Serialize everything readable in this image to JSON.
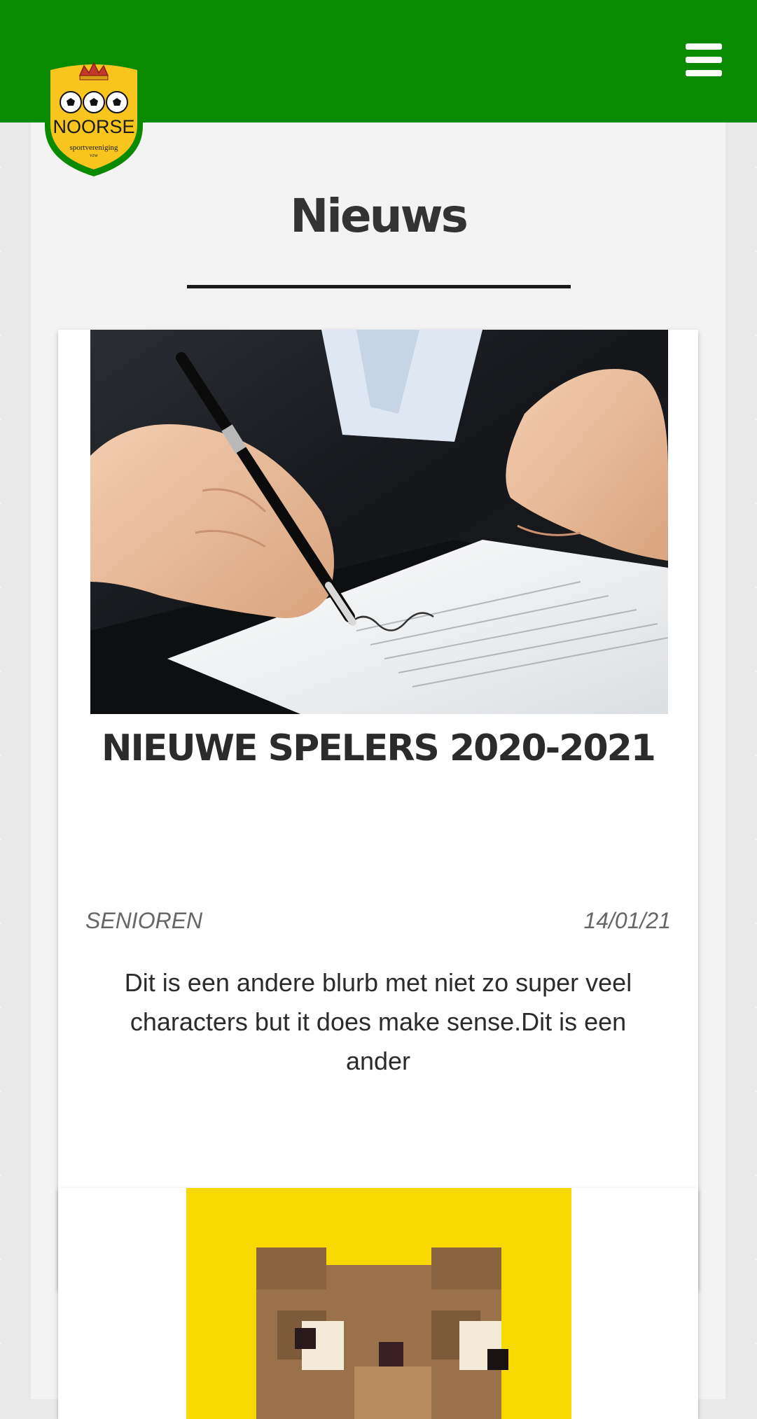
{
  "header": {
    "menu_icon": "hamburger-menu-icon",
    "bar_color": "#0a8a00"
  },
  "logo": {
    "text": "NOORSE",
    "subtext": "sportvereniging",
    "subtext2": "vzw",
    "colors": {
      "shield": "#f7c51e",
      "border": "#0a8a00"
    }
  },
  "page": {
    "title": "Nieuws"
  },
  "articles": [
    {
      "title": "NIEUWE SPELERS 2020-2021",
      "category": "SENIOREN",
      "date": "14/01/21",
      "blurb": "Dit is een andere blurb met niet zo super veel characters but it does make sense.Dit is een ander",
      "image": "signing-contract-photo"
    },
    {
      "image": "pixel-character-avatar"
    }
  ],
  "colors": {
    "accent_green": "#0a8a00",
    "title_text": "#333333",
    "meta_text": "#666666"
  }
}
